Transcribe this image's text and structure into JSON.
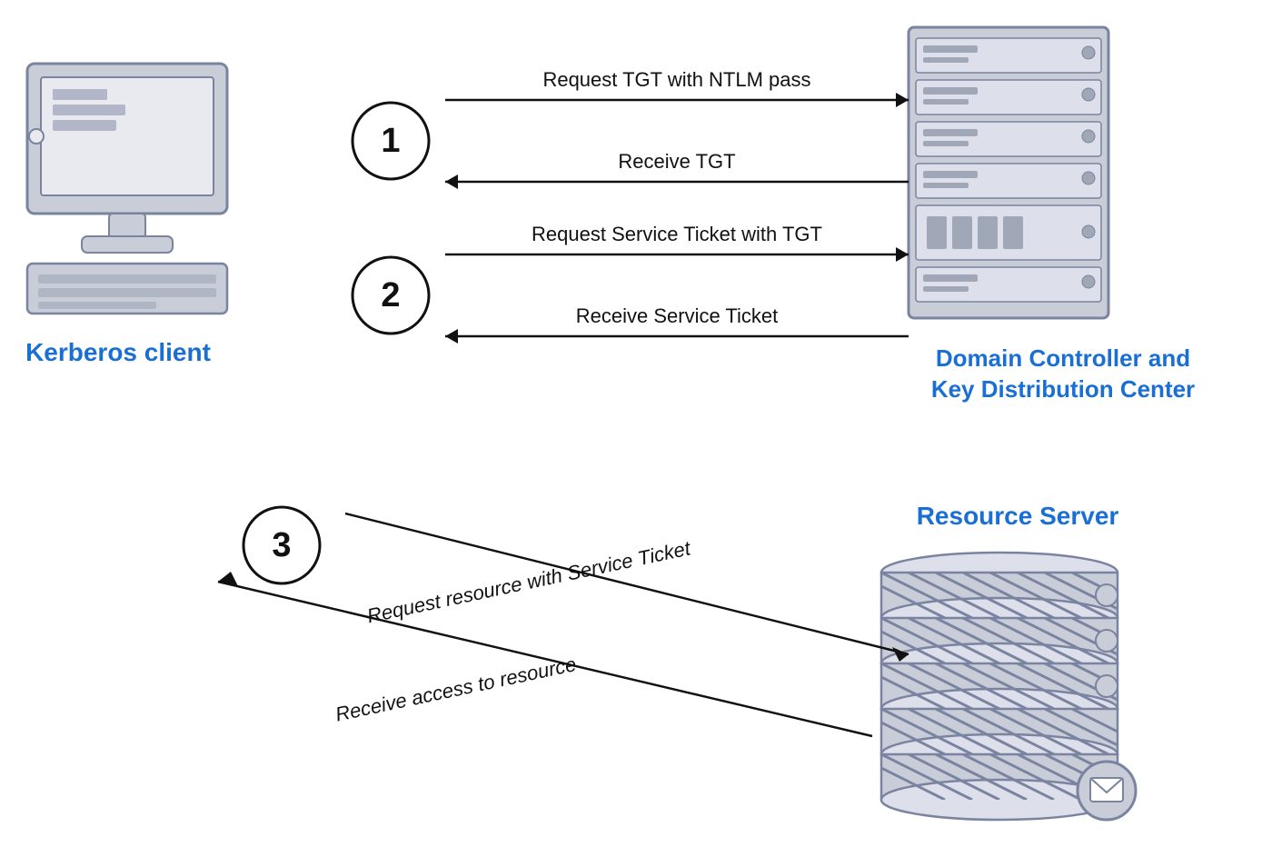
{
  "labels": {
    "kerberos_client": "Kerberos client",
    "domain_controller": "Domain Controller and\nKey Distribution Center",
    "resource_server": "Resource Server"
  },
  "arrows": {
    "step1_request": "Request TGT with NTLM pass",
    "step1_receive": "Receive TGT",
    "step2_request": "Request Service Ticket with TGT",
    "step2_receive": "Receive Service Ticket",
    "step3_request": "Request resource with Service Ticket",
    "step3_receive": "Receive access to resource"
  },
  "steps": [
    "1",
    "2",
    "3"
  ],
  "colors": {
    "blue": "#1a6fd4",
    "gray": "#a0a8b8",
    "dark_gray": "#6b7280",
    "server_body": "#c8cdd8",
    "server_stroke": "#7a84a0",
    "arrow": "#111111"
  }
}
